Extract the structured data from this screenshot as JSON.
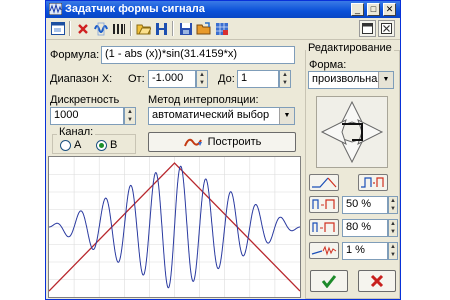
{
  "window": {
    "title": "Задатчик формы сигнала",
    "minimize": "_",
    "maximize": "□",
    "close": "✕"
  },
  "toolbar": {
    "icons": [
      "window-icon",
      "delete-icon",
      "wave-icon",
      "bars-icon",
      "open-icon",
      "h-icon",
      "save-icon",
      "folder-open-icon",
      "grid-icon"
    ],
    "right_icons": [
      "window-small-icon",
      "close-window-icon"
    ]
  },
  "formula": {
    "label": "Формула:",
    "value": "(1 - abs (x))*sin(31.4159*x)"
  },
  "range": {
    "label": "Диапазон X:",
    "from_label": "От:",
    "from": "-1.000",
    "to_label": "До:",
    "to": "1"
  },
  "discreteness": {
    "label": "Дискретность",
    "value": "1000"
  },
  "interpolation": {
    "label": "Метод интерполяции:",
    "value": "автоматический выбор"
  },
  "channel": {
    "label": "Канал:",
    "options": [
      "A",
      "B"
    ],
    "selected": "B"
  },
  "build_button": "Построить",
  "edit": {
    "title": "Редактирование",
    "form_label": "Форма:",
    "form_value": "произвольная",
    "params": [
      {
        "value": "50 %"
      },
      {
        "value": "80 %"
      },
      {
        "value": "1 %"
      }
    ]
  },
  "actions": {
    "ok_icon": "checkmark-icon",
    "cancel_icon": "cross-icon"
  },
  "colors": {
    "wave": "#2a3aa0",
    "envelope": "#b8282e",
    "accent_ok": "#1d8a2a",
    "accent_cancel": "#c8201e"
  }
}
